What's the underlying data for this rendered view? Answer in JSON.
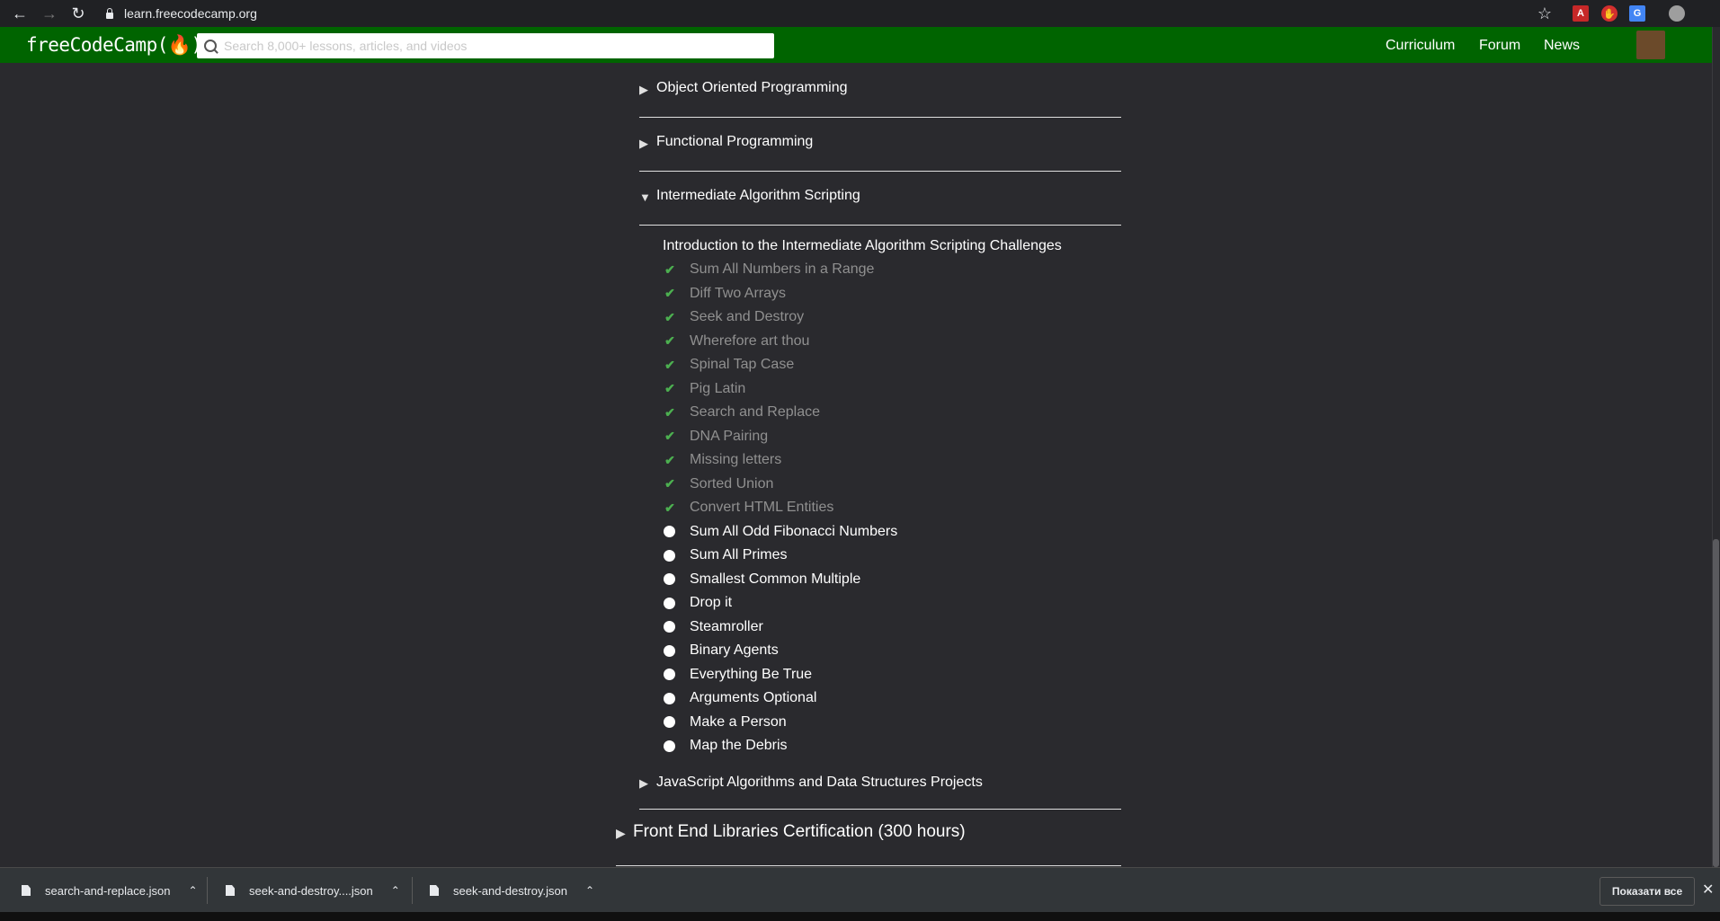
{
  "browser": {
    "url": "learn.freecodecamp.org"
  },
  "header": {
    "logo": "freeCodeCamp(🔥)",
    "search_placeholder": "Search 8,000+ lessons, articles, and videos",
    "nav": [
      "Curriculum",
      "Forum",
      "News"
    ]
  },
  "blocks": [
    {
      "label": "Object Oriented Programming",
      "expanded": false
    },
    {
      "label": "Functional Programming",
      "expanded": false
    },
    {
      "label": "Intermediate Algorithm Scripting",
      "expanded": true
    }
  ],
  "intro": "Introduction to the Intermediate Algorithm Scripting Challenges",
  "challenges": [
    {
      "title": "Sum All Numbers in a Range",
      "completed": true
    },
    {
      "title": "Diff Two Arrays",
      "completed": true
    },
    {
      "title": "Seek and Destroy",
      "completed": true
    },
    {
      "title": "Wherefore art thou",
      "completed": true
    },
    {
      "title": "Spinal Tap Case",
      "completed": true
    },
    {
      "title": "Pig Latin",
      "completed": true
    },
    {
      "title": "Search and Replace",
      "completed": true
    },
    {
      "title": "DNA Pairing",
      "completed": true
    },
    {
      "title": "Missing letters",
      "completed": true
    },
    {
      "title": "Sorted Union",
      "completed": true
    },
    {
      "title": "Convert HTML Entities",
      "completed": true
    },
    {
      "title": "Sum All Odd Fibonacci Numbers",
      "completed": false
    },
    {
      "title": "Sum All Primes",
      "completed": false
    },
    {
      "title": "Smallest Common Multiple",
      "completed": false
    },
    {
      "title": "Drop it",
      "completed": false
    },
    {
      "title": "Steamroller",
      "completed": false
    },
    {
      "title": "Binary Agents",
      "completed": false
    },
    {
      "title": "Everything Be True",
      "completed": false
    },
    {
      "title": "Arguments Optional",
      "completed": false
    },
    {
      "title": "Make a Person",
      "completed": false
    },
    {
      "title": "Map the Debris",
      "completed": false
    }
  ],
  "after_block": {
    "label": "JavaScript Algorithms and Data Structures Projects"
  },
  "certification": {
    "label": "Front End Libraries Certification (300 hours)"
  },
  "downloads": {
    "items": [
      "search-and-replace.json",
      "seek-and-destroy....json",
      "seek-and-destroy.json"
    ],
    "show_all": "Показати все"
  },
  "colors": {
    "header_bg": "#006400",
    "page_bg": "#2a2a2e",
    "check": "#4caf50"
  }
}
